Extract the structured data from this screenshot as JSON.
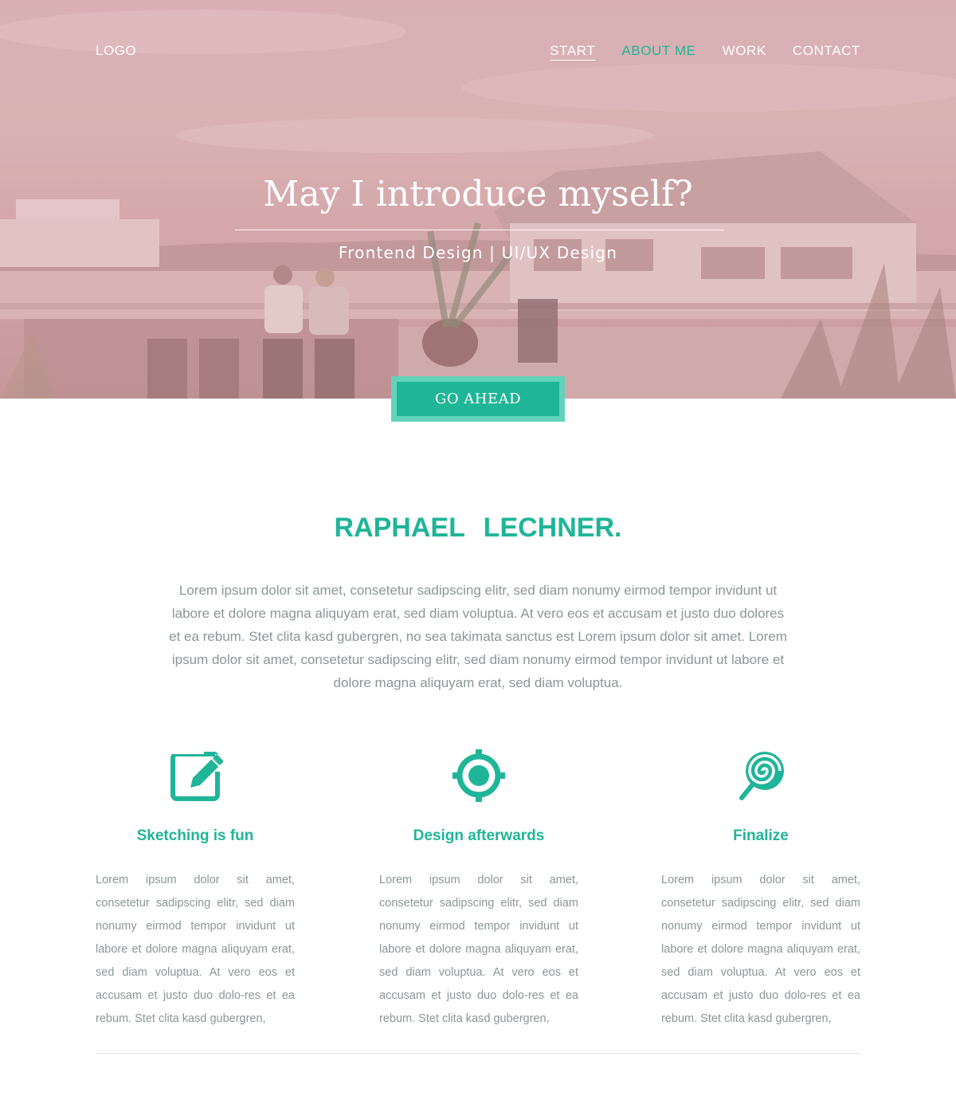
{
  "header": {
    "logo": "LOGO",
    "nav": [
      {
        "label": "START",
        "state": "active"
      },
      {
        "label": "ABOUT ME",
        "state": "current"
      },
      {
        "label": "WORK",
        "state": "normal"
      },
      {
        "label": "CONTACT",
        "state": "normal"
      }
    ]
  },
  "hero": {
    "title": "May I introduce myself?",
    "subtitle": "Frontend Design | UI/UX Design",
    "cta_label": "GO AHEAD"
  },
  "about": {
    "name": "RAPHAEL LECHNER.",
    "intro": "Lorem ipsum dolor sit amet, consetetur sadipscing elitr, sed diam nonumy eirmod tempor invidunt ut labore et dolore magna aliquyam erat, sed diam voluptua. At vero eos et accusam et justo duo dolores et ea rebum. Stet clita kasd gubergren, no sea takimata sanctus est Lorem ipsum dolor sit amet. Lorem ipsum dolor sit amet, consetetur sadipscing elitr, sed diam nonumy eirmod tempor invidunt ut labore et dolore magna aliquyam erat, sed diam voluptua."
  },
  "features": [
    {
      "icon": "edit-icon",
      "title": "Sketching is fun",
      "text": "Lorem ipsum dolor sit amet, consetetur sadipscing elitr, sed diam nonumy eirmod tempor invidunt ut labore et dolore magna aliquyam erat, sed diam voluptua. At vero eos et accusam et justo duo dolo-res et ea rebum. Stet clita kasd gubergren,"
    },
    {
      "icon": "target-icon",
      "title": "Design afterwards",
      "text": "Lorem ipsum dolor sit amet, consetetur sadipscing elitr, sed diam nonumy eirmod tempor invidunt ut labore et dolore magna aliquyam erat, sed diam voluptua. At vero eos et accusam et justo duo dolo-res et ea rebum. Stet clita kasd gubergren,"
    },
    {
      "icon": "lollipop-icon",
      "title": "Finalize",
      "text": "Lorem ipsum dolor sit amet, consetetur sadipscing elitr, sed diam nonumy eirmod tempor invidunt ut labore et dolore magna aliquyam erat, sed diam voluptua. At vero eos et accusam et justo duo dolo-res et ea rebum. Stet clita kasd gubergren,"
    }
  ],
  "colors": {
    "accent": "#1fb598",
    "accent_light": "#62d2bb",
    "body_text": "#8e9596",
    "hero_tint": "#d9b3b6"
  }
}
